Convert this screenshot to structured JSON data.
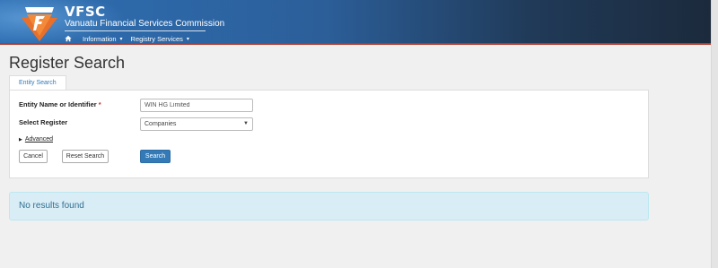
{
  "header": {
    "brand": "VFSC",
    "subtitle": "Vanuatu Financial Services Commission",
    "nav": [
      {
        "label": "Information"
      },
      {
        "label": "Registry Services"
      }
    ]
  },
  "page": {
    "title": "Register Search",
    "tabs": [
      {
        "label": "Entity Search"
      }
    ]
  },
  "form": {
    "entity_label": "Entity Name or Identifier",
    "required_mark": "*",
    "entity_value": "WIN HG Limited",
    "register_label": "Select Register",
    "register_value": "Companies",
    "advanced_label": "Advanced",
    "cancel_label": "Cancel",
    "reset_label": "Reset Search",
    "search_label": "Search"
  },
  "results": {
    "message": "No results found"
  },
  "colors": {
    "primary": "#337ab7",
    "alert_bg": "#d9edf7",
    "alert_text": "#31708f",
    "header_accent": "#b33a2a"
  },
  "icons": {
    "home": "home-icon",
    "logo": "vfsc-logo"
  }
}
